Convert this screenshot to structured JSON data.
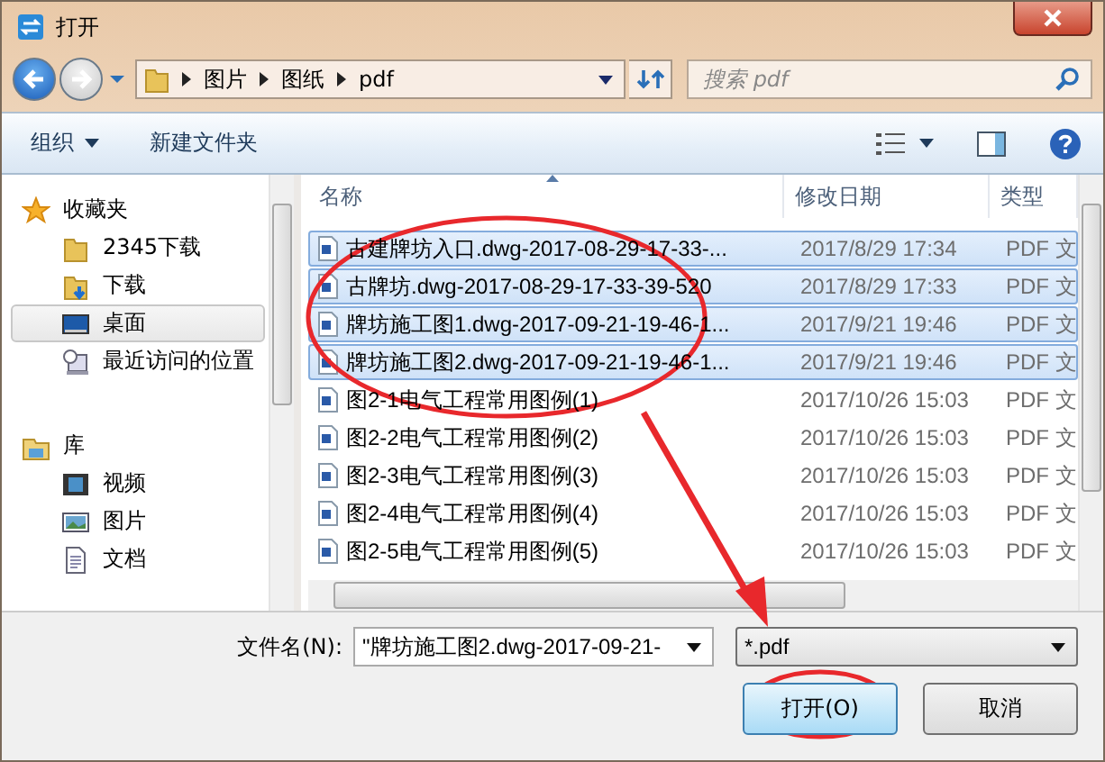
{
  "window": {
    "title": "打开"
  },
  "address_bar": {
    "path": [
      "图片",
      "图纸",
      "pdf"
    ]
  },
  "search": {
    "placeholder": "搜索 pdf"
  },
  "toolbar": {
    "items": [
      {
        "label": "组织",
        "dropdown": true
      },
      {
        "label": "新建文件夹",
        "dropdown": false
      }
    ]
  },
  "sidebar": {
    "items": [
      {
        "label": "收藏夹",
        "kind": "favorites",
        "selected": false,
        "children": [
          {
            "label": "2345下载",
            "kind": "folder",
            "selected": false
          },
          {
            "label": "下载",
            "kind": "download",
            "selected": false
          },
          {
            "label": "桌面",
            "kind": "desktop",
            "selected": true
          },
          {
            "label": "最近访问的位置",
            "kind": "recent",
            "selected": false
          }
        ]
      },
      {
        "label": "库",
        "kind": "library",
        "selected": false,
        "children": [
          {
            "label": "视频",
            "kind": "video",
            "selected": false
          },
          {
            "label": "图片",
            "kind": "pictures",
            "selected": false
          },
          {
            "label": "文档",
            "kind": "documents",
            "selected": false
          }
        ]
      }
    ]
  },
  "file_list": {
    "columns": [
      {
        "label": "名称",
        "sorted": true
      },
      {
        "label": "修改日期",
        "sorted": false
      },
      {
        "label": "类型",
        "sorted": false
      }
    ],
    "rows": [
      {
        "name": "古建牌坊入口.dwg-2017-08-29-17-33-...",
        "date": "2017/8/29 17:34",
        "type": "PDF 文",
        "selected": true
      },
      {
        "name": "古牌坊.dwg-2017-08-29-17-33-39-520",
        "date": "2017/8/29 17:33",
        "type": "PDF 文",
        "selected": true
      },
      {
        "name": "牌坊施工图1.dwg-2017-09-21-19-46-1...",
        "date": "2017/9/21 19:46",
        "type": "PDF 文",
        "selected": true
      },
      {
        "name": "牌坊施工图2.dwg-2017-09-21-19-46-1...",
        "date": "2017/9/21 19:46",
        "type": "PDF 文",
        "selected": true
      },
      {
        "name": "图2-1电气工程常用图例(1)",
        "date": "2017/10/26 15:03",
        "type": "PDF 文",
        "selected": false
      },
      {
        "name": "图2-2电气工程常用图例(2)",
        "date": "2017/10/26 15:03",
        "type": "PDF 文",
        "selected": false
      },
      {
        "name": "图2-3电气工程常用图例(3)",
        "date": "2017/10/26 15:03",
        "type": "PDF 文",
        "selected": false
      },
      {
        "name": "图2-4电气工程常用图例(4)",
        "date": "2017/10/26 15:03",
        "type": "PDF 文",
        "selected": false
      },
      {
        "name": "图2-5电气工程常用图例(5)",
        "date": "2017/10/26 15:03",
        "type": "PDF 文",
        "selected": false
      }
    ]
  },
  "file_name": {
    "label": "文件名(N):",
    "value": "\"牌坊施工图2.dwg-2017-09-21-"
  },
  "file_type": {
    "value": "*.pdf"
  },
  "buttons": [
    {
      "label": "打开(O)",
      "default": true
    },
    {
      "label": "取消",
      "default": false
    }
  ],
  "annotations": [
    {
      "kind": "ellipse"
    },
    {
      "kind": "arrow"
    },
    {
      "kind": "ellipse"
    }
  ]
}
